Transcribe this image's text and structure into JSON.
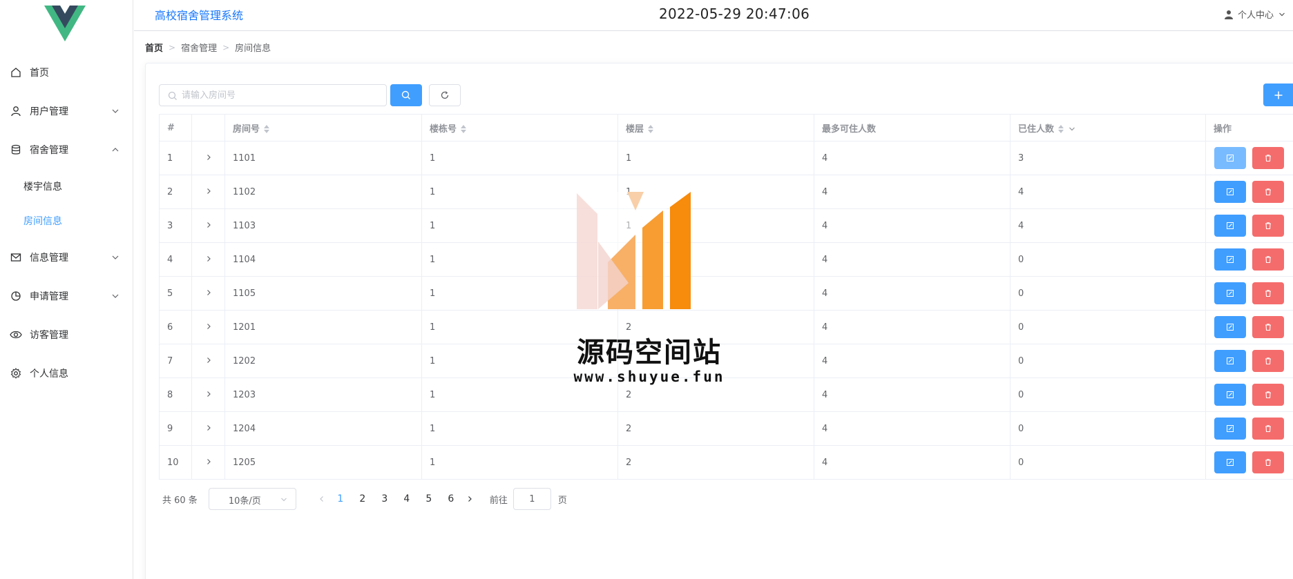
{
  "header": {
    "system_title": "高校宿舍管理系统",
    "datetime": "2022-05-29 20:47:06",
    "user_center": "个人中心"
  },
  "sidebar": {
    "items": [
      {
        "label": "首页",
        "icon": "home-icon"
      },
      {
        "label": "用户管理",
        "icon": "user-icon"
      },
      {
        "label": "宿舍管理",
        "icon": "database-icon"
      },
      {
        "label": "楼宇信息"
      },
      {
        "label": "房间信息"
      },
      {
        "label": "信息管理",
        "icon": "mail-icon"
      },
      {
        "label": "申请管理",
        "icon": "pie-chart-icon"
      },
      {
        "label": "访客管理",
        "icon": "eye-icon"
      },
      {
        "label": "个人信息",
        "icon": "gear-icon"
      }
    ],
    "active_item": "房间信息"
  },
  "breadcrumb": [
    "首页",
    "宿舍管理",
    "房间信息"
  ],
  "search": {
    "placeholder": "请输入房间号",
    "value": ""
  },
  "table": {
    "headers": [
      "#",
      "",
      "房间号",
      "楼栋号",
      "楼层",
      "最多可住人数",
      "已住人数",
      "操作"
    ],
    "rows": [
      {
        "index": "1",
        "room": "1101",
        "building": "1",
        "floor": "1",
        "max": "4",
        "current": "3"
      },
      {
        "index": "2",
        "room": "1102",
        "building": "1",
        "floor": "1",
        "max": "4",
        "current": "4"
      },
      {
        "index": "3",
        "room": "1103",
        "building": "1",
        "floor": "1",
        "max": "4",
        "current": "4"
      },
      {
        "index": "4",
        "room": "1104",
        "building": "1",
        "floor": "1",
        "max": "4",
        "current": "0"
      },
      {
        "index": "5",
        "room": "1105",
        "building": "1",
        "floor": "1",
        "max": "4",
        "current": "0"
      },
      {
        "index": "6",
        "room": "1201",
        "building": "1",
        "floor": "2",
        "max": "4",
        "current": "0"
      },
      {
        "index": "7",
        "room": "1202",
        "building": "1",
        "floor": "2",
        "max": "4",
        "current": "0"
      },
      {
        "index": "8",
        "room": "1203",
        "building": "1",
        "floor": "2",
        "max": "4",
        "current": "0"
      },
      {
        "index": "9",
        "room": "1204",
        "building": "1",
        "floor": "2",
        "max": "4",
        "current": "0"
      },
      {
        "index": "10",
        "room": "1205",
        "building": "1",
        "floor": "2",
        "max": "4",
        "current": "0"
      }
    ]
  },
  "pagination": {
    "total_text": "共 60 条",
    "page_size": "10条/页",
    "pages": [
      "1",
      "2",
      "3",
      "4",
      "5",
      "6"
    ],
    "current_page": "1",
    "goto_label": "前往",
    "goto_value": "1",
    "goto_unit": "页"
  },
  "watermark": {
    "text": "源码空间站",
    "url": "www.shuyue.fun"
  },
  "colors": {
    "primary": "#409eff",
    "danger": "#f56c6c",
    "title_blue": "#1677ff",
    "logo_green": "#41b883",
    "logo_dark": "#35495e",
    "watermark_orange": "#f78b0c"
  }
}
